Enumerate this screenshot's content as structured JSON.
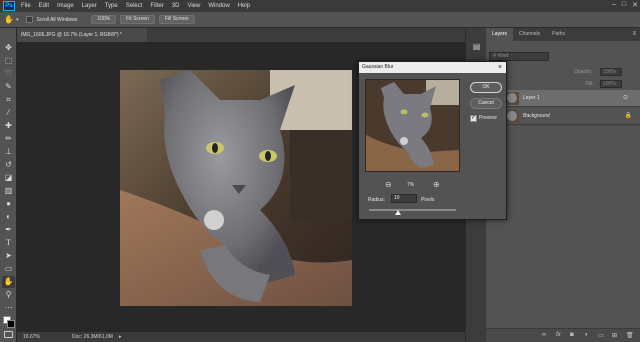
{
  "menubar": {
    "logo": "Ps",
    "items": [
      "File",
      "Edit",
      "Image",
      "Layer",
      "Type",
      "Select",
      "Filter",
      "3D",
      "View",
      "Window",
      "Help"
    ],
    "window_controls": [
      "–",
      "□",
      "✕"
    ]
  },
  "options": {
    "scroll_all_windows": "Scroll All Windows",
    "zoom_100": "100%",
    "fit_screen": "Fit Screen",
    "fill_screen": "Fill Screen"
  },
  "document": {
    "tab_title": "IMG_1606.JPG @ 16.7% (Layer 1, RGB/8*) *",
    "zoom": "16.67%",
    "doc_size": "Doc: 26.3M/61.0M"
  },
  "tools": [
    "move-tool",
    "marquee-tool",
    "lasso-tool",
    "quick-select-tool",
    "crop-tool",
    "eyedropper-tool",
    "healing-tool",
    "brush-tool",
    "clone-stamp-tool",
    "history-brush-tool",
    "eraser-tool",
    "gradient-tool",
    "blur-tool",
    "dodge-tool",
    "pen-tool",
    "type-tool",
    "path-select-tool",
    "shape-tool",
    "hand-tool",
    "zoom-tool"
  ],
  "panel": {
    "tabs": [
      "Layers",
      "Channels",
      "Paths"
    ],
    "search_placeholder": "Kind",
    "opacity_label": "Opacity:",
    "opacity_value": "100%",
    "fill_label": "Fill:",
    "fill_value": "100%",
    "layers": [
      {
        "name": "Layer 1",
        "selected": true
      },
      {
        "name": "Background",
        "selected": false
      }
    ]
  },
  "dialog": {
    "title": "Gaussian Blur",
    "ok_label": "OK",
    "cancel_label": "Cancel",
    "preview_label": "Preview",
    "preview_checked": true,
    "zoom_percent": "7%",
    "radius_label": "Radius:",
    "radius_value": "10",
    "units": "Pixels",
    "radius_slider_fraction": 0.33
  },
  "colors": {
    "accent": "#31a8ff",
    "panel_bg": "#535353",
    "canvas_bg": "#282828"
  }
}
